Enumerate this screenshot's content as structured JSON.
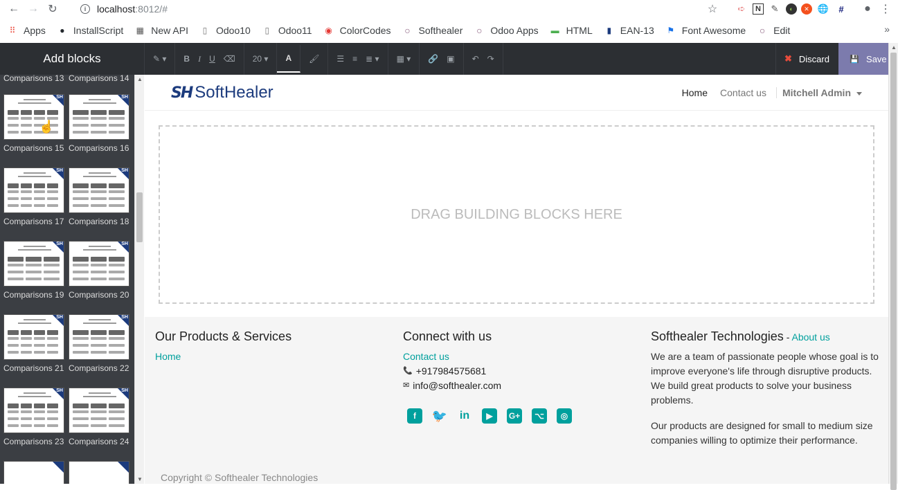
{
  "browser": {
    "url_host": "localhost",
    "url_path": ":8012/#",
    "info_glyph": "i",
    "bookmarks": [
      {
        "label": "Apps",
        "icon": "apps-grid-icon",
        "color": "#ea4335"
      },
      {
        "label": "InstallScript",
        "icon": "github-icon",
        "color": "#24292e"
      },
      {
        "label": "New API",
        "icon": "grid-doc-icon",
        "color": "#555"
      },
      {
        "label": "Odoo10",
        "icon": "page-icon",
        "color": "#777"
      },
      {
        "label": "Odoo11",
        "icon": "page-icon",
        "color": "#777"
      },
      {
        "label": "ColorCodes",
        "icon": "palette-icon",
        "color": "#e53935"
      },
      {
        "label": "Softhealer",
        "icon": "odoo-circle-icon",
        "color": "#875a7b"
      },
      {
        "label": "Odoo Apps",
        "icon": "odoo-circle-icon",
        "color": "#875a7b"
      },
      {
        "label": "HTML",
        "icon": "w3-icon",
        "color": "#4caf50"
      },
      {
        "label": "EAN-13",
        "icon": "barcode-icon",
        "color": "#1c3b7d"
      },
      {
        "label": "Font Awesome",
        "icon": "flag-icon",
        "color": "#1a73e8"
      },
      {
        "label": "Edit",
        "icon": "odoo-circle-icon",
        "color": "#875a7b"
      }
    ],
    "more_glyph": "»"
  },
  "editor": {
    "add_blocks_title": "Add blocks",
    "font_size": "20",
    "discard_label": "Discard",
    "save_label": "Save"
  },
  "blocks": [
    {
      "label": "Comparisons 13"
    },
    {
      "label": "Comparisons 14"
    },
    {
      "label": "Comparisons 15"
    },
    {
      "label": "Comparisons 16"
    },
    {
      "label": "Comparisons 17"
    },
    {
      "label": "Comparisons 18"
    },
    {
      "label": "Comparisons 19"
    },
    {
      "label": "Comparisons 20"
    },
    {
      "label": "Comparisons 21"
    },
    {
      "label": "Comparisons 22"
    },
    {
      "label": "Comparisons 23"
    },
    {
      "label": "Comparisons 24"
    }
  ],
  "site": {
    "logo_mark": "SH",
    "logo_text": "SoftHealer",
    "nav_home": "Home",
    "nav_contact": "Contact us",
    "nav_user": "Mitchell Admin",
    "dropzone_text": "DRAG BUILDING BLOCKS HERE"
  },
  "footer": {
    "col1_title": "Our Products & Services",
    "col1_link": "Home",
    "col2_title": "Connect with us",
    "col2_link": "Contact us",
    "phone": "+917984575681",
    "email": "info@softhealer.com",
    "col3_title": "Softhealer Technologies",
    "col3_sep": " - ",
    "col3_link": "About us",
    "about_p1": "We are a team of passionate people whose goal is to improve everyone's life through disruptive products. We build great products to solve your business problems.",
    "about_p2": "Our products are designed for small to medium size companies willing to optimize their performance.",
    "copyright": "Copyright © Softhealer Technologies",
    "social": [
      {
        "name": "facebook-icon",
        "glyph": "f"
      },
      {
        "name": "twitter-icon",
        "glyph": "🐦"
      },
      {
        "name": "linkedin-icon",
        "glyph": "in"
      },
      {
        "name": "youtube-icon",
        "glyph": "▶"
      },
      {
        "name": "google-plus-icon",
        "glyph": "G+"
      },
      {
        "name": "github-icon",
        "glyph": "⌥"
      },
      {
        "name": "instagram-icon",
        "glyph": "◎"
      }
    ]
  },
  "colors": {
    "accent": "#00a09d",
    "brand": "#1c3b7d",
    "save": "#7c7bad",
    "editor_bar": "#2c2f33"
  }
}
